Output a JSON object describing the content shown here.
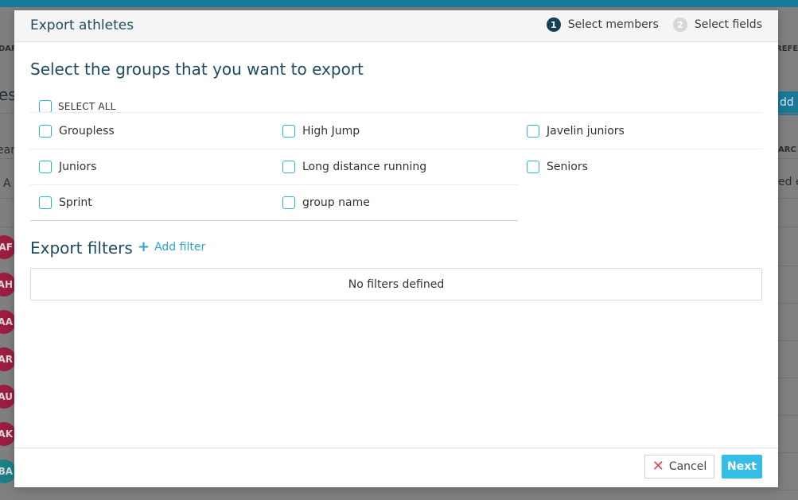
{
  "background": {
    "partial_texts": [
      "DAR",
      "REFE",
      "es",
      "ear",
      "A",
      "ARC",
      "ed e",
      "dd a"
    ],
    "avatars": [
      {
        "initials": "AF",
        "color": "#9b1d40"
      },
      {
        "initials": "AH",
        "color": "#9b1d40"
      },
      {
        "initials": "AA",
        "color": "#9b1d40"
      },
      {
        "initials": "AR",
        "color": "#9b1d40"
      },
      {
        "initials": "AU",
        "color": "#9b1d40"
      },
      {
        "initials": "AK",
        "color": "#9b1d40"
      },
      {
        "initials": "BA",
        "color": "#1d7f86"
      }
    ]
  },
  "modal": {
    "title": "Export athletes",
    "steps": [
      {
        "number": "1",
        "label": "Select members"
      },
      {
        "number": "2",
        "label": "Select fields"
      }
    ],
    "groups_section": {
      "title": "Select the groups that you want to export",
      "select_all_label": "SELECT ALL",
      "groups": [
        "Groupless",
        "High Jump",
        "Javelin juniors",
        "Juniors",
        "Long distance running",
        "Seniors",
        "Sprint",
        "group name"
      ]
    },
    "filters_section": {
      "title": "Export filters",
      "add_filter_label": "Add filter",
      "empty_text": "No filters defined"
    },
    "footer": {
      "cancel_label": "Cancel",
      "next_label": "Next"
    }
  },
  "colors": {
    "accent": "#35bde6",
    "title": "#1d4b61",
    "checkbox_border": "#2ab5d8",
    "cancel_icon": "#e2454e"
  }
}
